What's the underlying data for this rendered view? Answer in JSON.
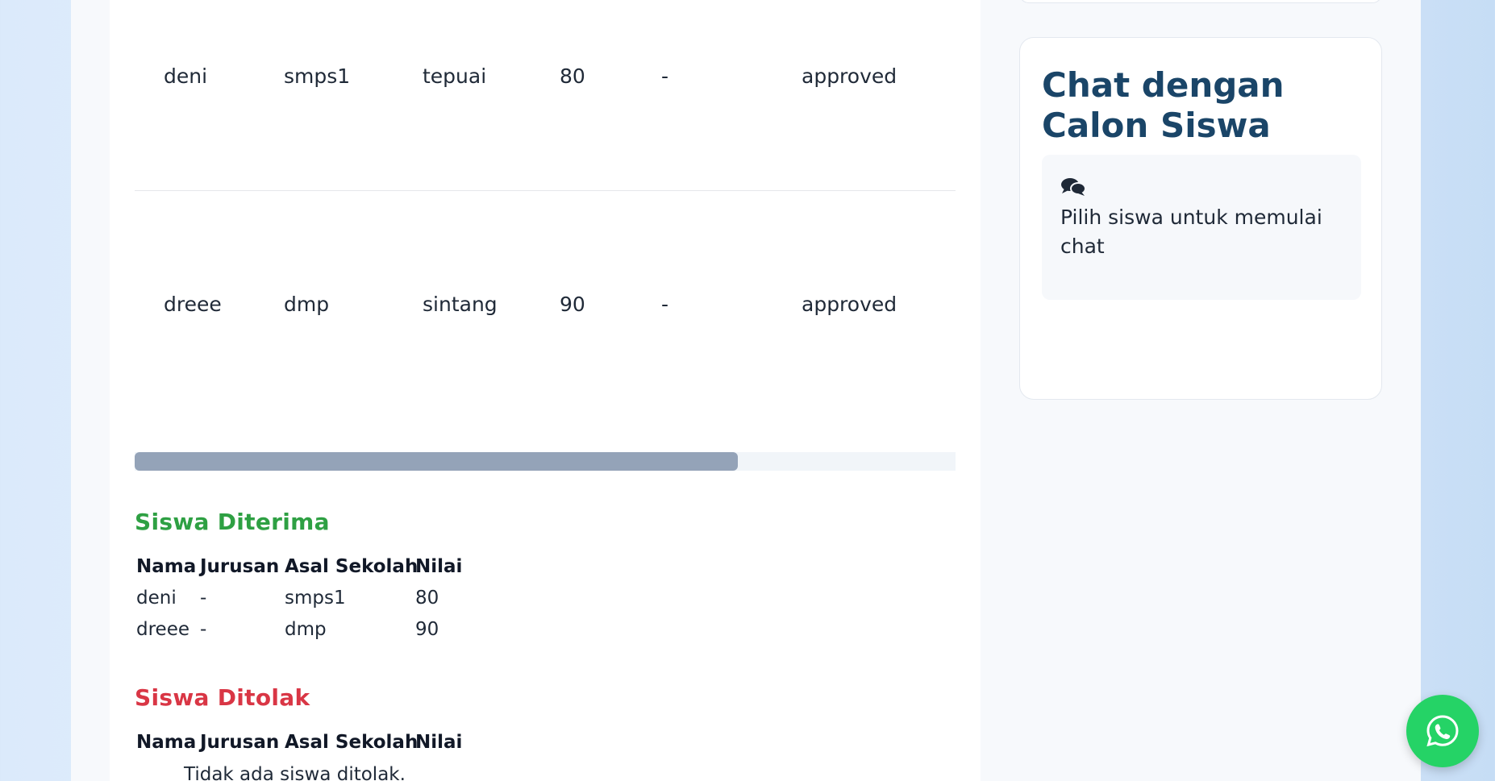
{
  "applicants_table": {
    "rows": [
      {
        "nama": "deni",
        "jurusan": "smps1",
        "asal": "tepuai",
        "nilai": "80",
        "keterangan": "-",
        "status": "approved"
      },
      {
        "nama": "dreee",
        "jurusan": "dmp",
        "asal": "sintang",
        "nilai": "90",
        "keterangan": "-",
        "status": "approved"
      }
    ]
  },
  "accepted": {
    "title": "Siswa Diterima",
    "headers": {
      "nama": "Nama",
      "jurusan": "Jurusan",
      "asal": "Asal Sekolah",
      "nilai": "Nilai"
    },
    "rows": [
      {
        "nama": "deni",
        "jurusan": "-",
        "asal": "smps1",
        "nilai": "80"
      },
      {
        "nama": "dreee",
        "jurusan": "-",
        "asal": "dmp",
        "nilai": "90"
      }
    ]
  },
  "rejected": {
    "title": "Siswa Ditolak",
    "headers": {
      "nama": "Nama",
      "jurusan": "Jurusan",
      "asal": "Asal Sekolah",
      "nilai": "Nilai"
    },
    "empty_message": "Tidak ada siswa ditolak."
  },
  "chat": {
    "title": "Chat dengan Calon Siswa",
    "empty_icon": "comments-icon",
    "empty_message": "Pilih siswa untuk memulai chat"
  },
  "whatsapp": {
    "icon": "whatsapp-icon",
    "color": "#25d366"
  },
  "colors": {
    "accepted": "#2ea043",
    "rejected": "#d93645",
    "chat_title": "#1a4568"
  }
}
